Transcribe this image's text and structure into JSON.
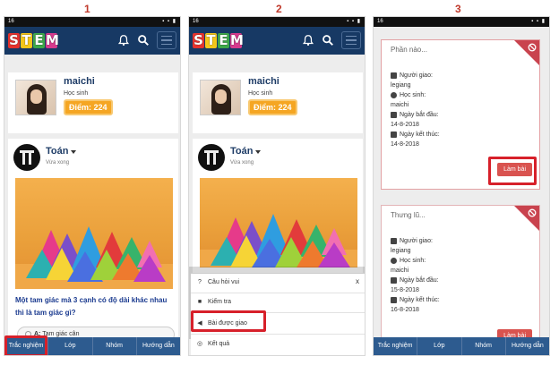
{
  "step_labels": [
    "1",
    "2",
    "3"
  ],
  "status_bar": {
    "time": "16"
  },
  "app": {
    "logo_letters": [
      "S",
      "T",
      "E",
      "M"
    ],
    "logo_colors": [
      "#e5322d",
      "#f4c61a",
      "#3da849",
      "#d63a8d"
    ]
  },
  "profile": {
    "name": "maichi",
    "role": "Học sinh",
    "score_label": "Điểm:",
    "score": "224"
  },
  "post": {
    "subject": "Toán",
    "time": "Vừa xong",
    "question": "Một tam giác mà 3 cạnh có độ dài khác nhau thì là tam giác gì?",
    "answer_a_label": "A:",
    "answer_a": "Tam giác cân"
  },
  "bottom_nav": [
    "Trắc nghiệm",
    "Lớp",
    "Nhóm",
    "Hướng dẫn"
  ],
  "menu_sheet": {
    "items": [
      {
        "icon": "question-icon",
        "label": "Câu hỏi vui"
      },
      {
        "icon": "briefcase-icon",
        "label": "Kiểm tra"
      },
      {
        "icon": "megaphone-icon",
        "label": "Bài được giao"
      },
      {
        "icon": "target-icon",
        "label": "Kết quả"
      }
    ],
    "close": "x"
  },
  "assignments": [
    {
      "title": "Phần nào...",
      "giver_label": "Người giao:",
      "giver": "legiang",
      "student_label": "Học sinh:",
      "student": "maichi",
      "start_label": "Ngày bắt đầu:",
      "start": "14-8-2018",
      "end_label": "Ngày kết thúc:",
      "end": "14-8-2018",
      "button": "Làm bài"
    },
    {
      "title": "Thưng lũ...",
      "giver_label": "Người giao:",
      "giver": "legiang",
      "student_label": "Học sinh:",
      "student": "maichi",
      "start_label": "Ngày bắt đầu:",
      "start": "15-8-2018",
      "end_label": "Ngày kết thúc:",
      "end": "16-8-2018",
      "button": "Làm bài"
    }
  ],
  "colors": {
    "header": "#173964",
    "nav": "#2d5b8f",
    "highlight": "#d7202a",
    "score": "#f5a623",
    "accent": "#d9534f"
  }
}
